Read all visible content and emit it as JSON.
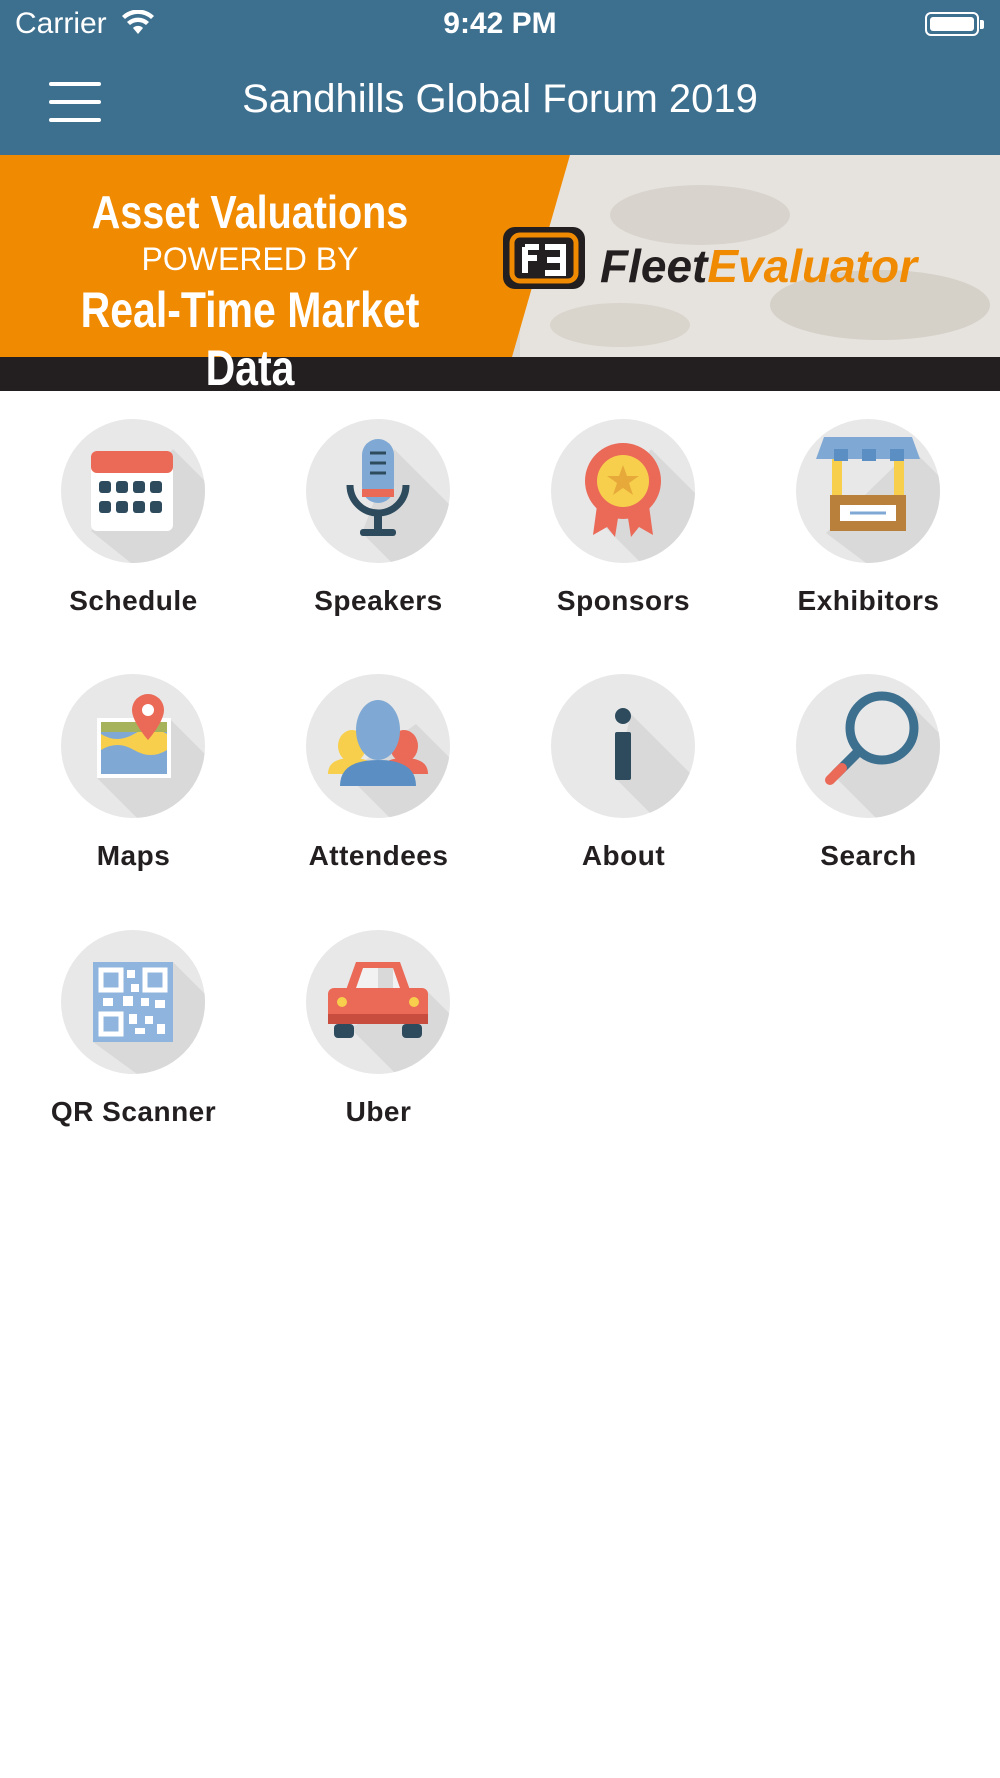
{
  "status_bar": {
    "carrier": "Carrier",
    "time": "9:42 PM"
  },
  "nav_bar": {
    "title": "Sandhills Global Forum 2019",
    "menu_icon": "hamburger-menu-icon"
  },
  "banner": {
    "line1": "Asset Valuations",
    "line2": "POWERED BY",
    "line3": "Real-Time Market Data",
    "brand_part1": "Fleet",
    "brand_part2": "Evaluator",
    "colors": {
      "orange": "#f08a00",
      "dark": "#231f20"
    }
  },
  "tiles": [
    {
      "label": "Schedule",
      "icon": "calendar-icon"
    },
    {
      "label": "Speakers",
      "icon": "microphone-icon"
    },
    {
      "label": "Sponsors",
      "icon": "award-ribbon-icon"
    },
    {
      "label": "Exhibitors",
      "icon": "booth-icon"
    },
    {
      "label": "Maps",
      "icon": "map-pin-icon"
    },
    {
      "label": "Attendees",
      "icon": "people-icon"
    },
    {
      "label": "About",
      "icon": "info-icon"
    },
    {
      "label": "Search",
      "icon": "magnifier-icon"
    },
    {
      "label": "QR Scanner",
      "icon": "qr-code-icon"
    },
    {
      "label": "Uber",
      "icon": "car-icon"
    }
  ],
  "colors": {
    "nav": "#3d6f8f",
    "tile_bg": "#e8e8e8",
    "text": "#231f20"
  }
}
